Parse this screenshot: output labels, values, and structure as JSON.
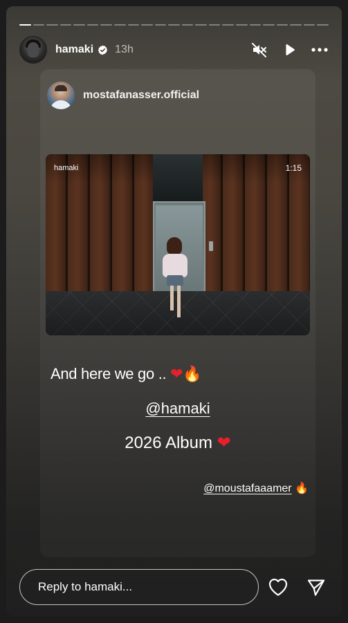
{
  "story": {
    "progress": {
      "segments": 23,
      "active_index": 0
    },
    "header": {
      "username": "hamaki",
      "verified": true,
      "time": "13h",
      "icons": [
        "mute-icon",
        "play-icon",
        "more-icon"
      ]
    },
    "card": {
      "author": "mostafanasser.official",
      "video": {
        "overlay_username": "hamaki",
        "duration": "1:15"
      },
      "caption": "And here we go ..",
      "caption_emojis": [
        "❤",
        "🔥"
      ],
      "mention": "@hamaki",
      "album_text": "2026 Album",
      "album_emoji": "❤",
      "small_mention": "@moustafaaamer",
      "small_mention_emoji": "🔥"
    },
    "reply": {
      "placeholder": "Reply to hamaki...",
      "icons": [
        "heart-icon",
        "send-icon"
      ]
    }
  },
  "colors": {
    "accent_red": "#e8202a",
    "fire": "#ff7a1a"
  }
}
